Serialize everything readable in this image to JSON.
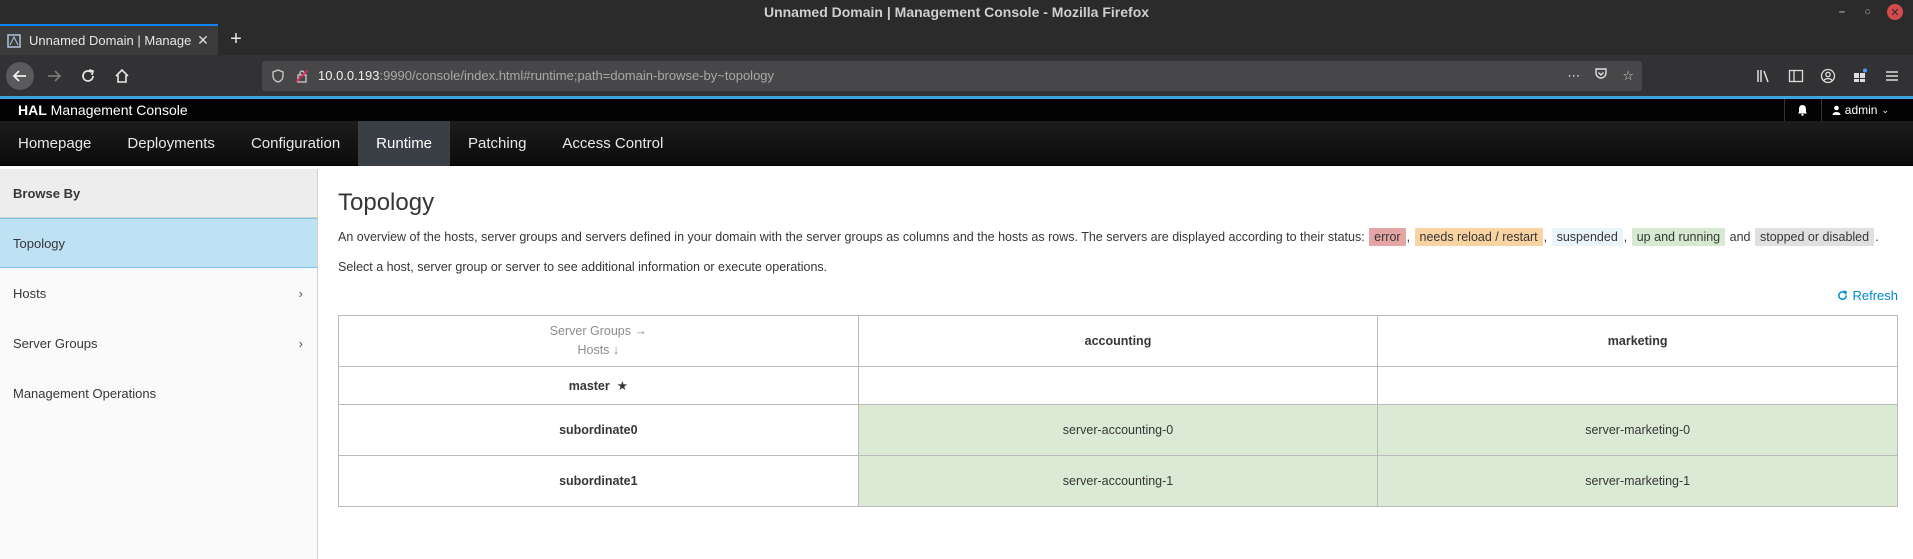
{
  "window": {
    "title": "Unnamed Domain | Management Console - Mozilla Firefox"
  },
  "browser": {
    "tab_title": "Unnamed Domain | Manage",
    "url_host": "10.0.0.193",
    "url_rest": ":9990/console/index.html#runtime;path=domain-browse-by~topology"
  },
  "hal": {
    "brand_bold": "HAL",
    "brand_rest": " Management Console",
    "user": "admin",
    "nav": [
      "Homepage",
      "Deployments",
      "Configuration",
      "Runtime",
      "Patching",
      "Access Control"
    ]
  },
  "sidebar": {
    "header": "Browse By",
    "items": [
      {
        "label": "Topology"
      },
      {
        "label": "Hosts"
      },
      {
        "label": "Server Groups"
      },
      {
        "label": "Management Operations"
      }
    ]
  },
  "main": {
    "title": "Topology",
    "desc_prefix": "An overview of the hosts, server groups and servers defined in your domain with the server groups as columns and the hosts as rows. The servers are displayed according to their status:",
    "status_labels": [
      "error",
      "needs reload / restart",
      "suspended",
      "up and running",
      "stopped or disabled"
    ],
    "desc_and": "and",
    "desc2": "Select a host, server group or server to see additional information or execute operations.",
    "refresh": "Refresh",
    "table": {
      "corner_top": "Server Groups →",
      "corner_bottom": "Hosts ↓",
      "groups": [
        "accounting",
        "marketing"
      ],
      "hosts": [
        "master",
        "subordinate0",
        "subordinate1"
      ],
      "servers": {
        "subordinate0": [
          "server-accounting-0",
          "server-marketing-0"
        ],
        "subordinate1": [
          "server-accounting-1",
          "server-marketing-1"
        ]
      }
    }
  },
  "colors": {
    "accent": "#39a5dc",
    "running": "#dbead5",
    "active_nav": "#bee1f4"
  }
}
